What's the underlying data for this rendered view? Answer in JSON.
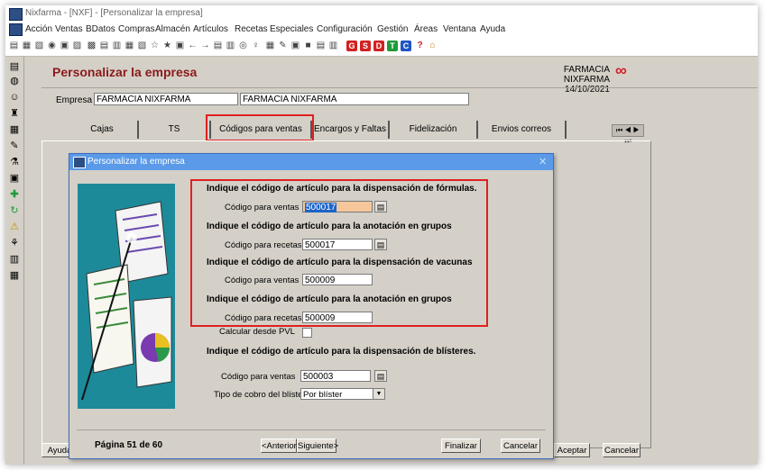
{
  "window": {
    "title": "Nixfarma - [NXF] - [Personalizar la empresa]"
  },
  "menu": [
    "Acción",
    "Ventas",
    "BDatos",
    "Compras",
    "Almacén",
    "Artículos",
    "Recetas",
    "Especiales",
    "Configuración",
    "Gestión",
    "Áreas",
    "Ventana",
    "Ayuda"
  ],
  "toolbar": {
    "color_buttons": [
      {
        "label": "G",
        "color": "#d22020"
      },
      {
        "label": "S",
        "color": "#d22020"
      },
      {
        "label": "D",
        "color": "#d22020"
      },
      {
        "label": "T",
        "color": "#1f9a3a"
      },
      {
        "label": "C",
        "color": "#1f55c4"
      }
    ],
    "help_label": "?"
  },
  "header": {
    "title": "Personalizar la empresa",
    "pharmacy": "FARMACIA NIXFARMA",
    "date": "14/10/2021"
  },
  "empresa": {
    "label": "Empresa",
    "code_value": "FARMACIA NIXFARMA",
    "name_value": "FARMACIA NIXFARMA"
  },
  "tabs": [
    {
      "label": "Cajas"
    },
    {
      "label": "TS"
    },
    {
      "label": "Códigos para ventas",
      "active": true
    },
    {
      "label": "Encargos y Faltas"
    },
    {
      "label": "Fidelización"
    },
    {
      "label": "Envios correos"
    }
  ],
  "tab_nav": "⏮ ◀ ▶ ⏭",
  "dialog": {
    "title": "Personalizar la empresa",
    "sections": [
      {
        "heading": "Indique el código de artículo para la dispensación  de fórmulas.",
        "field_label": "Código para ventas",
        "value": "500017"
      },
      {
        "heading": "Indique el código de artículo para la anotación en grupos",
        "field_label": "Código para recetas",
        "value": "500017"
      },
      {
        "heading": "Indique el código de artículo para la dispensación  de vacunas",
        "field_label": "Código para ventas",
        "value": "500009"
      },
      {
        "heading": "Indique el código de artículo para la anotación en grupos",
        "field_label": "Código para recetas",
        "value": "500009"
      },
      {
        "heading": "Indique el código de artículo para la dispensación  de blísteres.",
        "field_label": "Código para ventas",
        "value": "500003"
      }
    ],
    "calc_label": "Calcular desde PVL",
    "tipo_label": "Tipo de cobro del blíster",
    "tipo_value": "Por blíster",
    "page": "Página 51 de 60",
    "btn_prev": "<Anterior",
    "btn_next": "Siguiente>",
    "btn_finish": "Finalizar",
    "btn_cancel": "Cancelar"
  },
  "main_buttons": {
    "help": "Ayuda",
    "accept": "Aceptar",
    "cancel": "Cancelar"
  },
  "colors": {
    "title_red": "#8b1a1a",
    "highlight": "#e02020",
    "dialog_title": "#5a9ae8"
  }
}
